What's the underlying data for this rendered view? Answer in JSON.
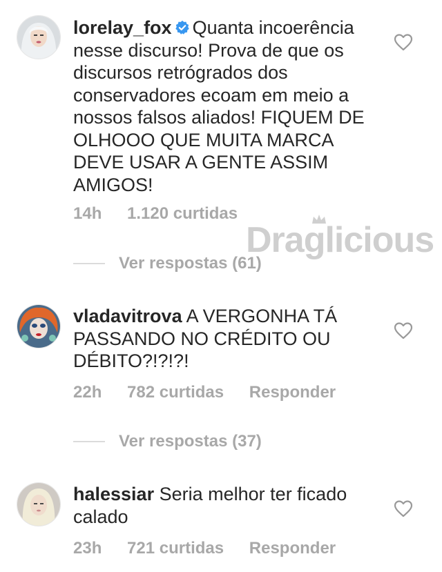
{
  "watermark": {
    "text": "Draglicious"
  },
  "comments": [
    {
      "username": "lorelay_fox",
      "verified": true,
      "text": "Quanta incoerência nesse discurso! Prova de que os discursos retrógrados dos conservadores ecoam em meio a nossos falsos aliados! FIQUEM DE OLHOOO QUE MUITA MARCA DEVE USAR A GENTE ASSIM AMIGOS!",
      "time": "14h",
      "likes": "1.120 curtidas",
      "replies": "Ver respostas (61)"
    },
    {
      "username": "vladavitrova",
      "verified": false,
      "text": "A VERGONHA TÁ PASSANDO NO CRÉDITO OU DÉBITO?!?!?!",
      "time": "22h",
      "likes": "782 curtidas",
      "reply_label": "Responder",
      "replies": "Ver respostas (37)"
    },
    {
      "username": "halessiar",
      "verified": false,
      "text": "Seria melhor ter ficado calado",
      "time": "23h",
      "likes": "721 curtidas",
      "reply_label": "Responder"
    }
  ],
  "colors": {
    "text": "#262626",
    "meta": "#a8a8a8",
    "verified": "#3897f0",
    "watermark": "#cfcfcf"
  }
}
